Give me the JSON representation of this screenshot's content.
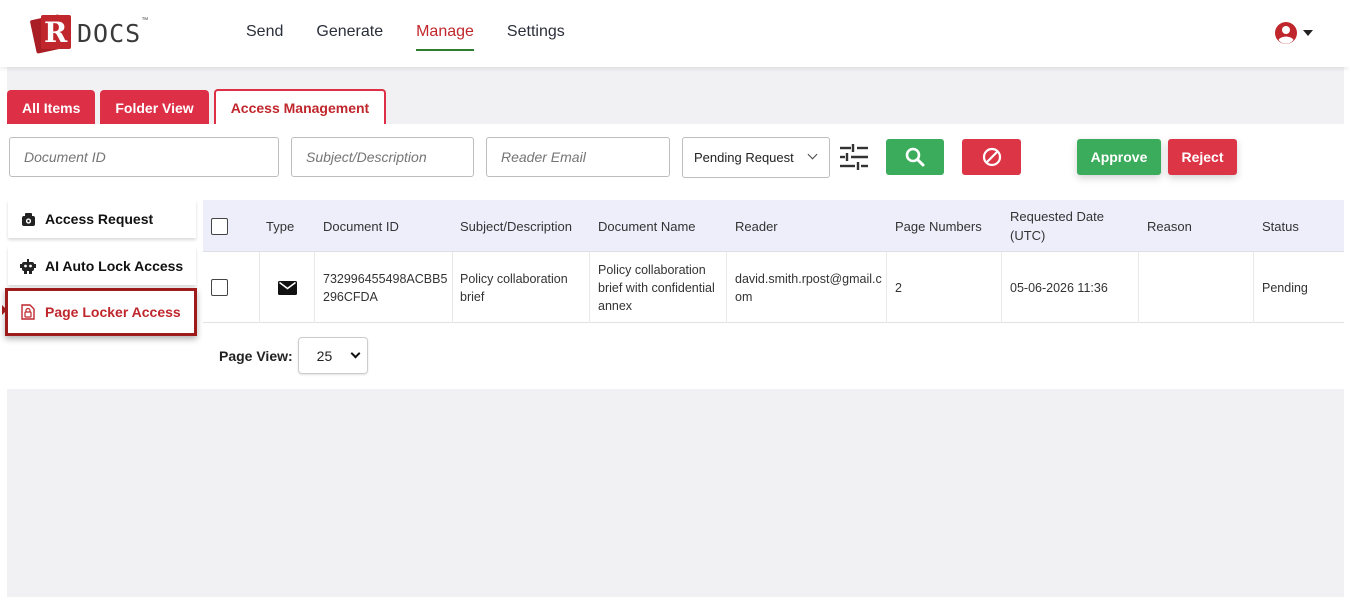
{
  "app": {
    "logo_letter": "R",
    "logo_text": "DOCS",
    "logo_tm": "™"
  },
  "nav": {
    "items": [
      {
        "label": "Send"
      },
      {
        "label": "Generate"
      },
      {
        "label": "Manage",
        "active": true
      },
      {
        "label": "Settings"
      }
    ]
  },
  "user_menu": {
    "icon": "user-circle-icon"
  },
  "tabs": [
    {
      "label": "All Items"
    },
    {
      "label": "Folder View"
    },
    {
      "label": "Access Management",
      "active": true
    }
  ],
  "filters": {
    "document_id_placeholder": "Document ID",
    "subject_placeholder": "Subject/Description",
    "reader_email_placeholder": "Reader Email",
    "status_select": "Pending Request",
    "approve_label": "Approve",
    "reject_label": "Reject"
  },
  "sidebar": {
    "items": [
      {
        "label": "Access Request",
        "icon": "lock-camera-icon"
      },
      {
        "label": "AI Auto Lock Access",
        "icon": "robot-lock-icon"
      },
      {
        "label": "Page Locker Access",
        "icon": "page-lock-icon",
        "active": true
      }
    ]
  },
  "table": {
    "headers": {
      "type": "Type",
      "document_id": "Document ID",
      "subject": "Subject/Description",
      "document_name": "Document Name",
      "reader": "Reader",
      "page_numbers": "Page Numbers",
      "requested_date_1": "Requested Date",
      "requested_date_2": "(UTC)",
      "reason": "Reason",
      "status": "Status"
    },
    "rows": [
      {
        "type_icon": "envelope-icon",
        "document_id_1": "732996455498ACBB5",
        "document_id_2": "296CFDA",
        "subject_1": "Policy collaboration",
        "subject_2": "brief",
        "document_name_1": "Policy collaboration",
        "document_name_2": "brief with confidential",
        "document_name_3": "annex",
        "reader_1": "david.smith.rpost@gmail.c",
        "reader_2": "om",
        "page_numbers": "2",
        "requested_date": "05-06-2026 11:36",
        "reason": "",
        "status": "Pending"
      }
    ]
  },
  "pager": {
    "label": "Page View:",
    "value": "25"
  },
  "colors": {
    "brand_red": "#dd2f45",
    "success_green": "#3bab5c",
    "danger_red": "#dc3545",
    "active_underline": "#2f7d32"
  }
}
